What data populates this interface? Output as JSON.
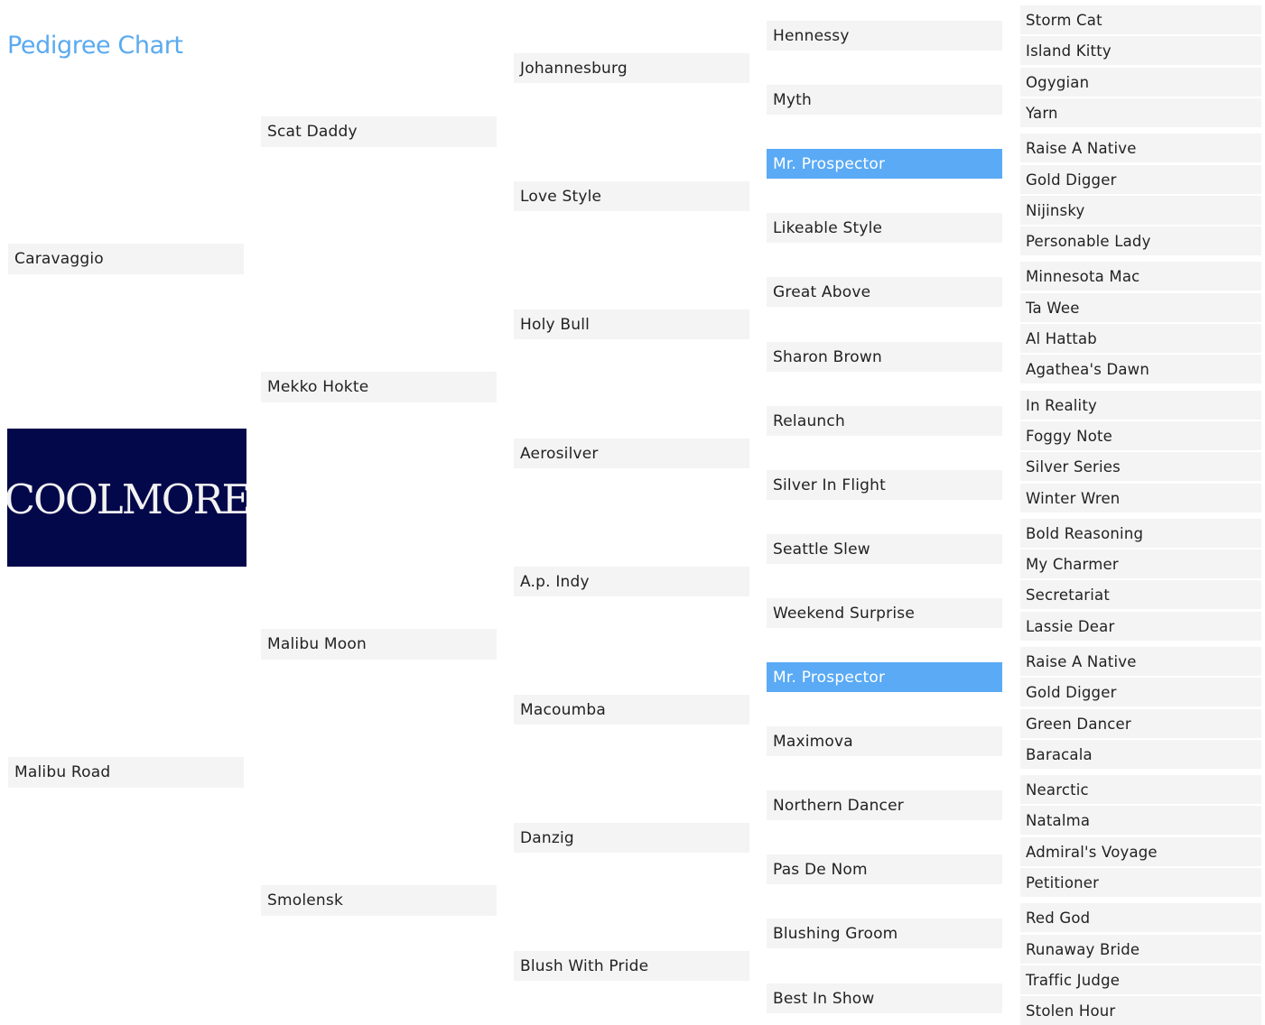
{
  "title": "Pedigree Chart",
  "colors": {
    "title": "#5aaaf0",
    "highlight": "#5aaaf5",
    "cell_bg": "#f4f4f4",
    "logo_bg": "#03084a"
  },
  "logo": {
    "text": "COOLMORE"
  },
  "horse": {
    "sire": "Caravaggio",
    "dam": "Malibu Road"
  },
  "gen2": [
    "Scat Daddy",
    "Mekko Hokte",
    "Malibu Moon",
    "Smolensk"
  ],
  "gen3": [
    "Johannesburg",
    "Love Style",
    "Holy Bull",
    "Aerosilver",
    "A.p. Indy",
    "Macoumba",
    "Danzig",
    "Blush With Pride"
  ],
  "gen4": [
    {
      "name": "Hennessy"
    },
    {
      "name": "Myth"
    },
    {
      "name": "Mr. Prospector",
      "highlight": true
    },
    {
      "name": "Likeable Style"
    },
    {
      "name": "Great Above"
    },
    {
      "name": "Sharon Brown"
    },
    {
      "name": "Relaunch"
    },
    {
      "name": "Silver In Flight"
    },
    {
      "name": "Seattle Slew"
    },
    {
      "name": "Weekend Surprise"
    },
    {
      "name": "Mr. Prospector",
      "highlight": true
    },
    {
      "name": "Maximova"
    },
    {
      "name": "Northern Dancer"
    },
    {
      "name": "Pas De Nom"
    },
    {
      "name": "Blushing Groom"
    },
    {
      "name": "Best In Show"
    }
  ],
  "gen5": [
    "Storm Cat",
    "Island Kitty",
    "Ogygian",
    "Yarn",
    "Raise A Native",
    "Gold Digger",
    "Nijinsky",
    "Personable Lady",
    "Minnesota Mac",
    "Ta Wee",
    "Al Hattab",
    "Agathea's Dawn",
    "In Reality",
    "Foggy Note",
    "Silver Series",
    "Winter Wren",
    "Bold Reasoning",
    "My Charmer",
    "Secretariat",
    "Lassie Dear",
    "Raise A Native",
    "Gold Digger",
    "Green Dancer",
    "Baracala",
    "Nearctic",
    "Natalma",
    "Admiral's Voyage",
    "Petitioner",
    "Red God",
    "Runaway Bride",
    "Traffic Judge",
    "Stolen Hour"
  ]
}
